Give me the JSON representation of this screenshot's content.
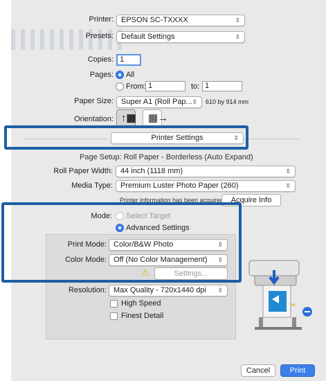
{
  "printer": {
    "label": "Printer:",
    "value": "EPSON SC-TXXXX"
  },
  "presets": {
    "label": "Presets:",
    "value": "Default Settings"
  },
  "copies": {
    "label": "Copies:",
    "value": "1"
  },
  "pages": {
    "label": "Pages:",
    "all_label": "All",
    "from_label": "From:",
    "from_value": "1",
    "to_label": "to:",
    "to_value": "1"
  },
  "paper_size": {
    "label": "Paper Size:",
    "value": "Super A1 (Roll Pap...",
    "dims": "610 by 914 mm"
  },
  "orientation": {
    "label": "Orientation:"
  },
  "section_popup": {
    "value": "Printer Settings"
  },
  "page_setup": {
    "text": "Page Setup: Roll Paper - Borderless (Auto Expand)"
  },
  "roll_paper_width": {
    "label": "Roll Paper Width:",
    "value": "44 inch (1118 mm)"
  },
  "media_type": {
    "label": "Media Type:",
    "value": "Premium Luster Photo Paper (260)"
  },
  "printer_info": {
    "text": "Printer information has been acquired.",
    "button": "Acquire Info"
  },
  "mode": {
    "label": "Mode:",
    "select_target": "Select Target",
    "advanced": "Advanced Settings"
  },
  "print_mode": {
    "label": "Print Mode:",
    "value": "Color/B&W Photo"
  },
  "color_mode": {
    "label": "Color Mode:",
    "value": "Off (No Color Management)"
  },
  "settings_button": "Settings...",
  "resolution": {
    "label": "Resolution:",
    "value": "Max Quality - 720x1440 dpi"
  },
  "high_speed": "High Speed",
  "finest_detail": "Finest Detail",
  "buttons": {
    "cancel": "Cancel",
    "print": "Print"
  },
  "colors": {
    "highlight": "#1d5fa5",
    "accent": "#3b7ee8",
    "dialog_bg": "#e9e9e9"
  },
  "icons": [
    "chevron-updown-icon",
    "portrait-orientation-icon",
    "landscape-orientation-icon",
    "warning-icon",
    "printer-illustration-icon"
  ]
}
